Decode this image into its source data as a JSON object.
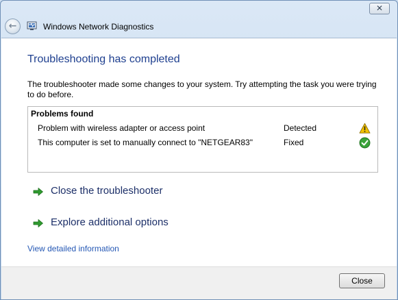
{
  "window": {
    "title": "Windows Network Diagnostics",
    "close_glyph": "✕",
    "back_glyph": "←"
  },
  "content": {
    "heading": "Troubleshooting has completed",
    "description": "The troubleshooter made some changes to your system. Try attempting the task you were trying to do before.",
    "problems": {
      "title": "Problems found",
      "rows": [
        {
          "description": "Problem with wireless adapter or access point",
          "status": "Detected",
          "icon": "warning-icon"
        },
        {
          "description": "This computer is set to manually connect to \"NETGEAR83\"",
          "status": "Fixed",
          "icon": "check-icon"
        }
      ]
    },
    "actions": [
      {
        "label": "Close the troubleshooter",
        "icon": "green-arrow-icon"
      },
      {
        "label": "Explore additional options",
        "icon": "green-arrow-icon"
      }
    ],
    "detail_link": "View detailed information"
  },
  "footer": {
    "close_label": "Close"
  },
  "colors": {
    "heading": "#1e3f8f",
    "link": "#2457b4",
    "action_text": "#1c2f68",
    "warning": "#f2c200",
    "success": "#3aa33a",
    "arrow": "#2f9a2f"
  }
}
